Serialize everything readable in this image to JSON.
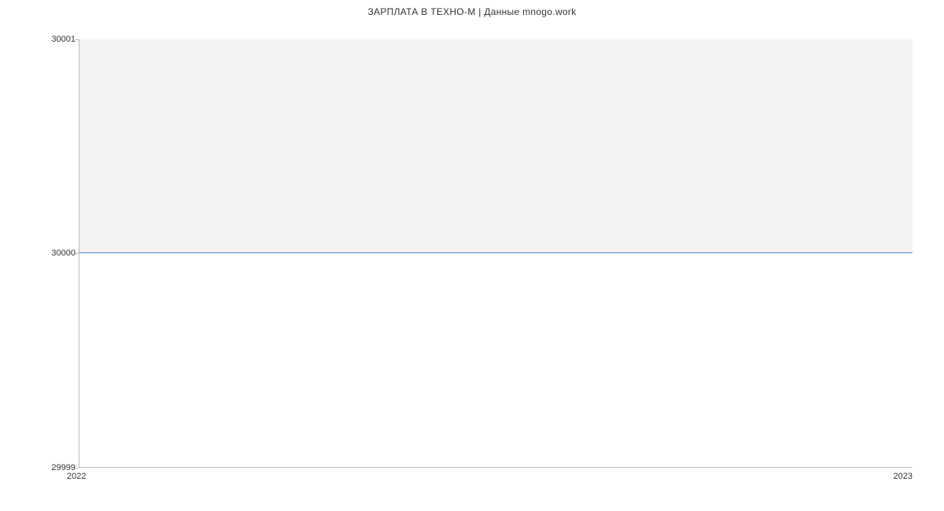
{
  "chart_data": {
    "type": "area",
    "title": "ЗАРПЛАТА В ТЕХНО-М | Данные mnogo.work",
    "x": [
      2022,
      2023
    ],
    "values": [
      30000,
      30000
    ],
    "xlabel": "",
    "ylabel": "",
    "xlim": [
      2022,
      2023
    ],
    "ylim": [
      29999,
      30001
    ],
    "x_ticks": [
      2022,
      2023
    ],
    "y_ticks": [
      29999,
      30000,
      30001
    ],
    "line_color": "#4a7fe0",
    "fill_color": "#f3f3f3"
  }
}
